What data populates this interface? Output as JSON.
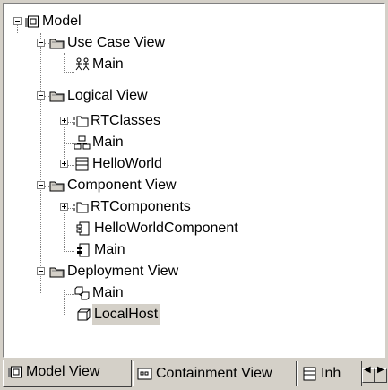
{
  "tree": {
    "root": {
      "label": "Model",
      "icon": "model-package-icon"
    },
    "items": [
      {
        "label": "Use Case View",
        "icon": "folder-view-icon"
      },
      {
        "label": "Main",
        "icon": "usecase-diagram-icon"
      },
      {
        "label": "Logical View",
        "icon": "folder-view-icon"
      },
      {
        "label": "RTClasses",
        "icon": "package-folder-icon"
      },
      {
        "label": "Main",
        "icon": "class-diagram-icon"
      },
      {
        "label": "HelloWorld",
        "icon": "capsule-icon"
      },
      {
        "label": "Component View",
        "icon": "folder-view-icon"
      },
      {
        "label": "RTComponents",
        "icon": "package-folder-icon"
      },
      {
        "label": "HelloWorldComponent",
        "icon": "component-icon"
      },
      {
        "label": "Main",
        "icon": "component-diagram-icon"
      },
      {
        "label": "Deployment View",
        "icon": "folder-view-icon"
      },
      {
        "label": "Main",
        "icon": "deployment-diagram-icon"
      },
      {
        "label": "LocalHost",
        "icon": "node-icon"
      }
    ],
    "selected": "LocalHost"
  },
  "tabs": [
    {
      "label": "Model View",
      "icon": "model-view-icon",
      "active": true
    },
    {
      "label": "Containment View",
      "icon": "containment-view-icon",
      "active": false
    },
    {
      "label": "Inh",
      "icon": "inheritance-view-icon",
      "active": false
    }
  ],
  "scroll": {
    "left": "◀",
    "right": "▶"
  }
}
